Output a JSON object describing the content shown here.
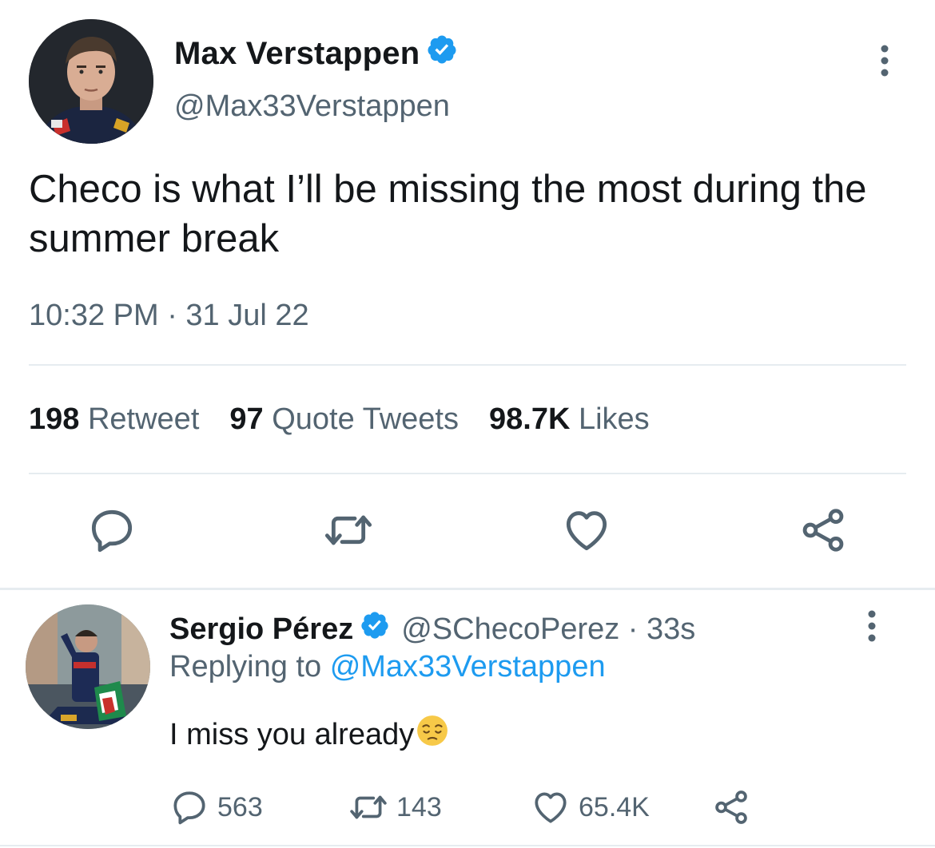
{
  "tweet": {
    "author_name": "Max Verstappen",
    "handle": "@Max33Verstappen",
    "text": "Checo is what I’ll be missing the most during the summer break",
    "timestamp": "10:32 PM · 31 Jul 22",
    "stats": {
      "retweets_count": "198",
      "retweets_label": "Retweet",
      "quotes_count": "97",
      "quotes_label": "Quote Tweets",
      "likes_count": "98.7K",
      "likes_label": "Likes"
    },
    "icons": {
      "more": "more-vertical-icon",
      "reply": "reply-icon",
      "retweet": "retweet-icon",
      "like": "heart-icon",
      "share": "share-icon",
      "verified": "verified-badge-icon"
    }
  },
  "reply": {
    "author_name": "Sergio Pérez",
    "handle_time": "@SChecoPerez · 33s",
    "replying_prefix": "Replying to",
    "replying_mention": "@Max33Verstappen",
    "text": "I miss you already",
    "emoji": "😔",
    "counts": {
      "replies": "563",
      "retweets": "143",
      "likes": "65.4K"
    }
  },
  "colors": {
    "text_primary": "#14171a",
    "text_secondary": "#536471",
    "accent_blue": "#1d9bf0",
    "divider": "#e6ecf0"
  }
}
